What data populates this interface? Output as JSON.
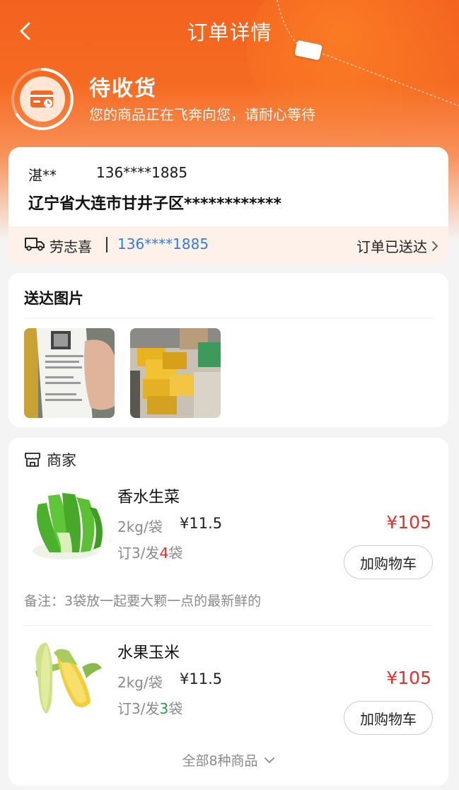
{
  "header": {
    "title": "订单详情",
    "back_icon": "chevron-left-icon"
  },
  "status": {
    "title": "待收货",
    "subtitle": "您的商品正在飞奔向您，请耐心等待",
    "icon": "delivery-card-icon"
  },
  "address": {
    "name": "湛**",
    "phone": "136****1885",
    "line": "辽宁省大连市甘井子区************"
  },
  "courier": {
    "icon": "truck-icon",
    "name": "劳志喜",
    "separator": "|",
    "phone": "136****1885",
    "status": "订单已送达",
    "chevron": "chevron-right-icon"
  },
  "delivery_photos": {
    "title": "送达图片",
    "items": [
      {
        "name": "receipt-photo"
      },
      {
        "name": "packages-photo"
      }
    ]
  },
  "merchant": {
    "icon": "store-icon",
    "label": "商家"
  },
  "goods": [
    {
      "name": "香水生菜",
      "spec": "2kg/袋",
      "unit_price": "¥11.5",
      "qty_order": "订3/发",
      "qty_sent": "4",
      "qty_unit": "袋",
      "total": "¥105",
      "cart_label": "加购物车",
      "remark": "备注：3袋放一起要大颗一点的最新鲜的"
    },
    {
      "name": "水果玉米",
      "spec": "2kg/袋",
      "unit_price": "¥11.5",
      "qty_order": "订3/发",
      "qty_sent": "3",
      "qty_unit": "袋",
      "total": "¥105",
      "cart_label": "加购物车"
    }
  ],
  "show_all": {
    "label": "全部8种商品",
    "icon": "chevron-down-icon"
  },
  "colors": {
    "brand_orange": "#f4621f",
    "price_red": "#e0312c",
    "link_blue": "#2f7fe0",
    "over_qty_red": "#e0312c",
    "exact_qty_green": "#2f9a4b"
  }
}
